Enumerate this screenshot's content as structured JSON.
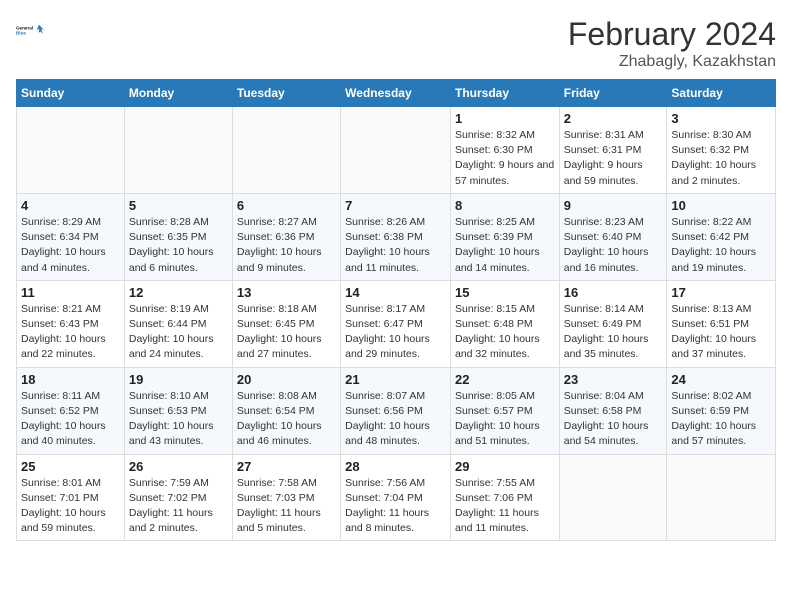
{
  "header": {
    "logo_line1": "General",
    "logo_line2": "Blue",
    "title": "February 2024",
    "location": "Zhabagly, Kazakhstan"
  },
  "weekdays": [
    "Sunday",
    "Monday",
    "Tuesday",
    "Wednesday",
    "Thursday",
    "Friday",
    "Saturday"
  ],
  "weeks": [
    [
      {
        "num": "",
        "info": ""
      },
      {
        "num": "",
        "info": ""
      },
      {
        "num": "",
        "info": ""
      },
      {
        "num": "",
        "info": ""
      },
      {
        "num": "1",
        "info": "Sunrise: 8:32 AM\nSunset: 6:30 PM\nDaylight: 9 hours and 57 minutes."
      },
      {
        "num": "2",
        "info": "Sunrise: 8:31 AM\nSunset: 6:31 PM\nDaylight: 9 hours and 59 minutes."
      },
      {
        "num": "3",
        "info": "Sunrise: 8:30 AM\nSunset: 6:32 PM\nDaylight: 10 hours and 2 minutes."
      }
    ],
    [
      {
        "num": "4",
        "info": "Sunrise: 8:29 AM\nSunset: 6:34 PM\nDaylight: 10 hours and 4 minutes."
      },
      {
        "num": "5",
        "info": "Sunrise: 8:28 AM\nSunset: 6:35 PM\nDaylight: 10 hours and 6 minutes."
      },
      {
        "num": "6",
        "info": "Sunrise: 8:27 AM\nSunset: 6:36 PM\nDaylight: 10 hours and 9 minutes."
      },
      {
        "num": "7",
        "info": "Sunrise: 8:26 AM\nSunset: 6:38 PM\nDaylight: 10 hours and 11 minutes."
      },
      {
        "num": "8",
        "info": "Sunrise: 8:25 AM\nSunset: 6:39 PM\nDaylight: 10 hours and 14 minutes."
      },
      {
        "num": "9",
        "info": "Sunrise: 8:23 AM\nSunset: 6:40 PM\nDaylight: 10 hours and 16 minutes."
      },
      {
        "num": "10",
        "info": "Sunrise: 8:22 AM\nSunset: 6:42 PM\nDaylight: 10 hours and 19 minutes."
      }
    ],
    [
      {
        "num": "11",
        "info": "Sunrise: 8:21 AM\nSunset: 6:43 PM\nDaylight: 10 hours and 22 minutes."
      },
      {
        "num": "12",
        "info": "Sunrise: 8:19 AM\nSunset: 6:44 PM\nDaylight: 10 hours and 24 minutes."
      },
      {
        "num": "13",
        "info": "Sunrise: 8:18 AM\nSunset: 6:45 PM\nDaylight: 10 hours and 27 minutes."
      },
      {
        "num": "14",
        "info": "Sunrise: 8:17 AM\nSunset: 6:47 PM\nDaylight: 10 hours and 29 minutes."
      },
      {
        "num": "15",
        "info": "Sunrise: 8:15 AM\nSunset: 6:48 PM\nDaylight: 10 hours and 32 minutes."
      },
      {
        "num": "16",
        "info": "Sunrise: 8:14 AM\nSunset: 6:49 PM\nDaylight: 10 hours and 35 minutes."
      },
      {
        "num": "17",
        "info": "Sunrise: 8:13 AM\nSunset: 6:51 PM\nDaylight: 10 hours and 37 minutes."
      }
    ],
    [
      {
        "num": "18",
        "info": "Sunrise: 8:11 AM\nSunset: 6:52 PM\nDaylight: 10 hours and 40 minutes."
      },
      {
        "num": "19",
        "info": "Sunrise: 8:10 AM\nSunset: 6:53 PM\nDaylight: 10 hours and 43 minutes."
      },
      {
        "num": "20",
        "info": "Sunrise: 8:08 AM\nSunset: 6:54 PM\nDaylight: 10 hours and 46 minutes."
      },
      {
        "num": "21",
        "info": "Sunrise: 8:07 AM\nSunset: 6:56 PM\nDaylight: 10 hours and 48 minutes."
      },
      {
        "num": "22",
        "info": "Sunrise: 8:05 AM\nSunset: 6:57 PM\nDaylight: 10 hours and 51 minutes."
      },
      {
        "num": "23",
        "info": "Sunrise: 8:04 AM\nSunset: 6:58 PM\nDaylight: 10 hours and 54 minutes."
      },
      {
        "num": "24",
        "info": "Sunrise: 8:02 AM\nSunset: 6:59 PM\nDaylight: 10 hours and 57 minutes."
      }
    ],
    [
      {
        "num": "25",
        "info": "Sunrise: 8:01 AM\nSunset: 7:01 PM\nDaylight: 10 hours and 59 minutes."
      },
      {
        "num": "26",
        "info": "Sunrise: 7:59 AM\nSunset: 7:02 PM\nDaylight: 11 hours and 2 minutes."
      },
      {
        "num": "27",
        "info": "Sunrise: 7:58 AM\nSunset: 7:03 PM\nDaylight: 11 hours and 5 minutes."
      },
      {
        "num": "28",
        "info": "Sunrise: 7:56 AM\nSunset: 7:04 PM\nDaylight: 11 hours and 8 minutes."
      },
      {
        "num": "29",
        "info": "Sunrise: 7:55 AM\nSunset: 7:06 PM\nDaylight: 11 hours and 11 minutes."
      },
      {
        "num": "",
        "info": ""
      },
      {
        "num": "",
        "info": ""
      }
    ]
  ]
}
